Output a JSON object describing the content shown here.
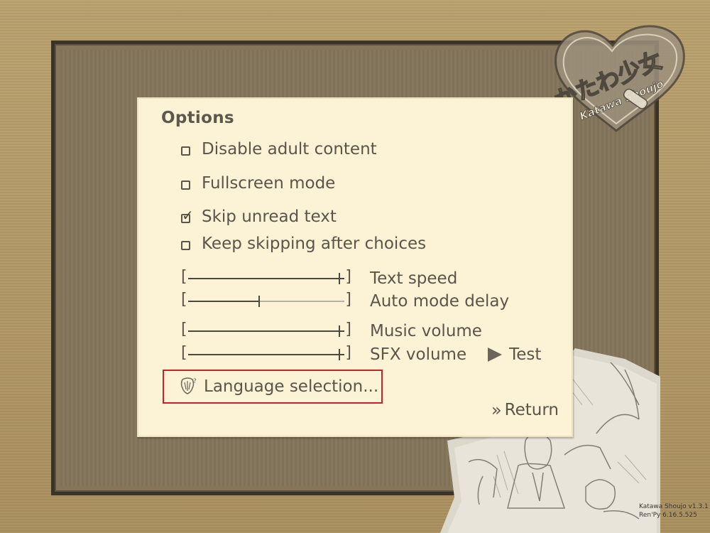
{
  "panel": {
    "title": "Options",
    "checkboxes": [
      {
        "label": "Disable adult content",
        "checked": false
      },
      {
        "label": "Fullscreen mode",
        "checked": false
      },
      {
        "label": "Skip unread text",
        "checked": true
      },
      {
        "label": "Keep skipping after choices",
        "checked": false
      }
    ],
    "check_mark": "✓",
    "sliders": [
      {
        "label": "Text speed",
        "value": 1.0
      },
      {
        "label": "Auto mode delay",
        "value": 0.45
      },
      {
        "label": "Music volume",
        "value": 1.0
      },
      {
        "label": "SFX volume",
        "value": 1.0
      }
    ],
    "test_label": "Test",
    "language_label": "Language selection...",
    "return_label": "Return",
    "return_chevrons": "»",
    "bracket_left": "[",
    "bracket_right": "]"
  },
  "logo": {
    "japanese": "かたわ少女",
    "latin": "Katawa Shoujo"
  },
  "version": {
    "line1": "Katawa Shoujo v1.3.1",
    "line2": "Ren'Py 6.16.5.525"
  },
  "colors": {
    "background": "#b39a68",
    "frame": "#84755b",
    "panel": "#fcf3d7",
    "text": "#5b5449",
    "highlight": "#c8222a"
  }
}
